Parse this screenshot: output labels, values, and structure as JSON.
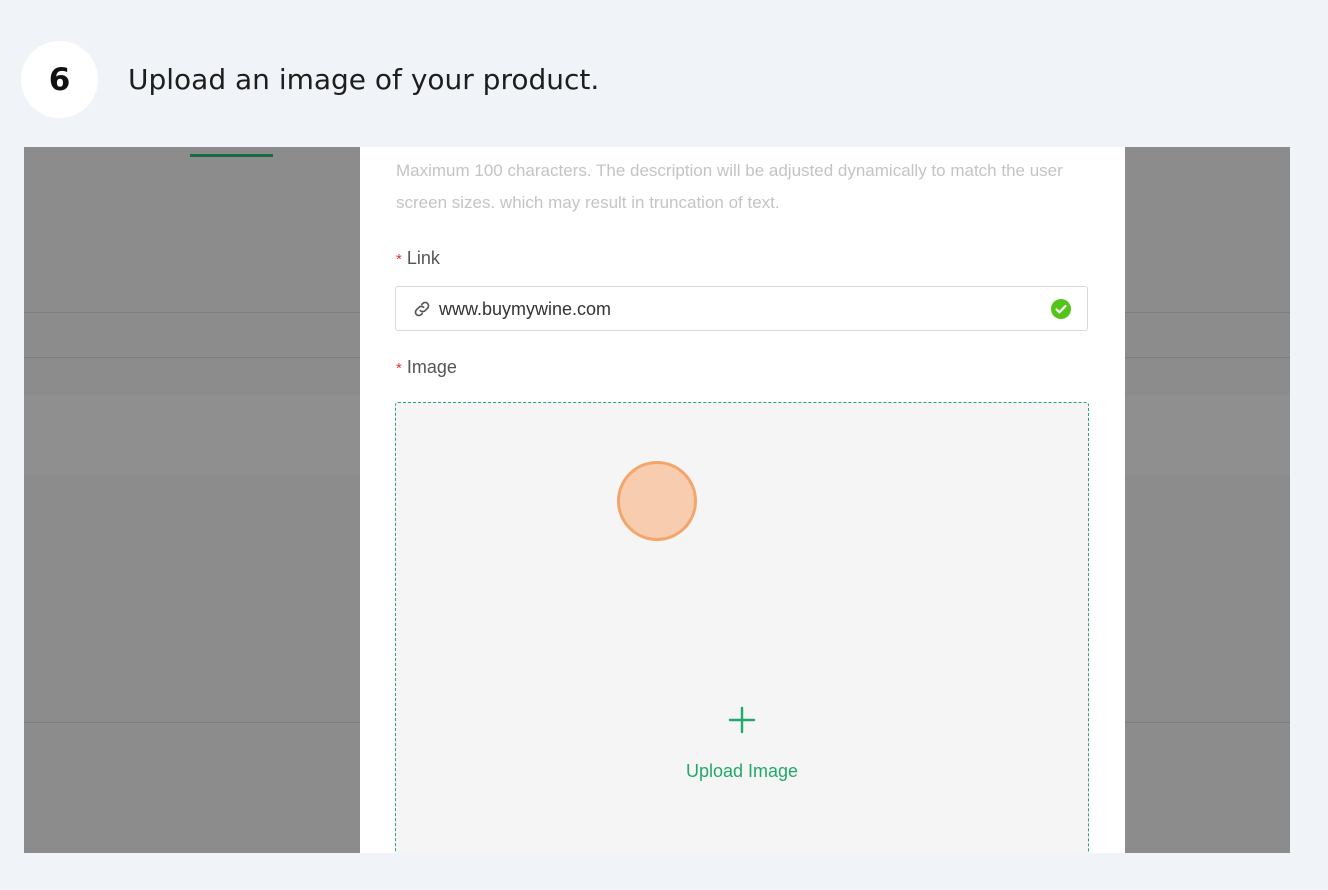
{
  "step": {
    "number": "6",
    "title": "Upload an image of your product."
  },
  "form": {
    "helper_text": "Maximum 100 characters. The description will be adjusted dynamically to match the user screen sizes. which may result in truncation of text.",
    "link": {
      "required_mark": "*",
      "label": "Link",
      "value": "www.buymywine.com",
      "prefix_icon": "link-icon",
      "status_icon": "check-circle-icon"
    },
    "image": {
      "required_mark": "*",
      "label": "Image",
      "upload_icon": "plus-icon",
      "upload_label": "Upload Image"
    }
  },
  "colors": {
    "accent_green": "#22a86a",
    "success_green": "#52c41a",
    "required_red": "#d83a3a",
    "click_marker": "#f4a56b"
  }
}
